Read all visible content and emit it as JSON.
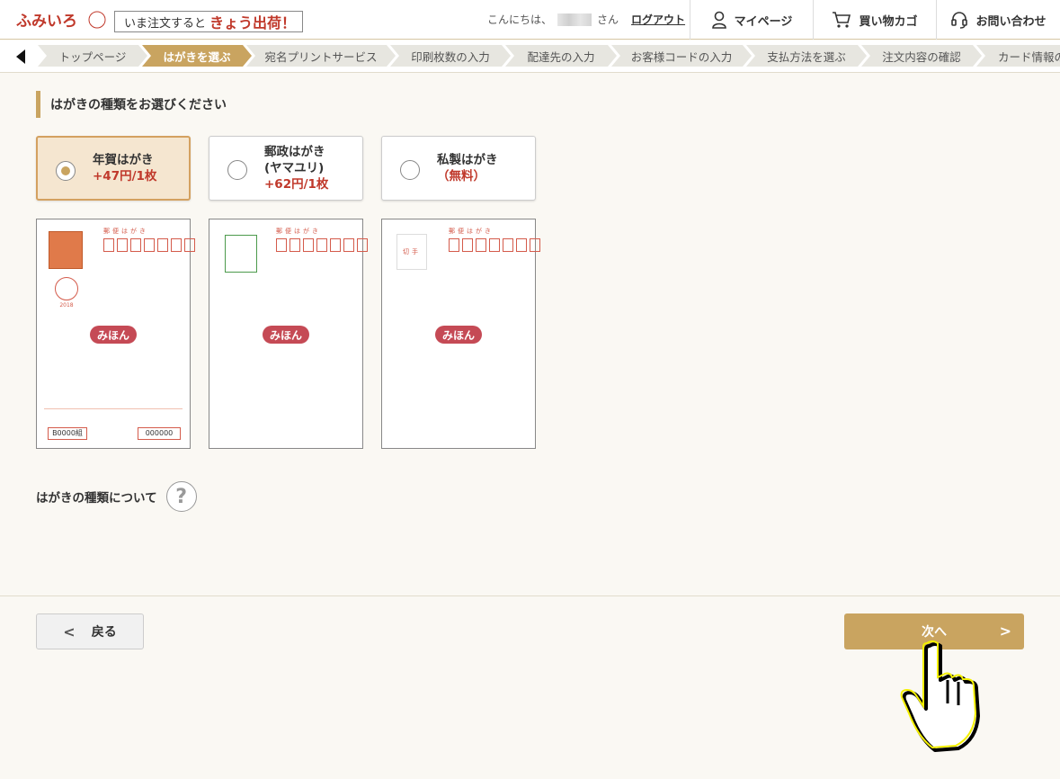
{
  "header": {
    "logo_text": "ふみいろ",
    "promo_prefix": "いま注文すると",
    "promo_strong": "きょう出荷！",
    "greeting_prefix": "こんにちは、",
    "greeting_suffix": "さん",
    "logout": "ログアウト",
    "nav": [
      {
        "label": "マイページ",
        "icon": "user-icon"
      },
      {
        "label": "買い物カゴ",
        "icon": "cart-icon"
      },
      {
        "label": "お問い合わせ",
        "icon": "headset-icon"
      }
    ]
  },
  "steps": [
    {
      "label": "トップページ",
      "active": false
    },
    {
      "label": "はがきを選ぶ",
      "active": true
    },
    {
      "label": "宛名プリントサービス",
      "active": false
    },
    {
      "label": "印刷枚数の入力",
      "active": false
    },
    {
      "label": "配達先の入力",
      "active": false
    },
    {
      "label": "お客様コードの入力",
      "active": false
    },
    {
      "label": "支払方法を選ぶ",
      "active": false
    },
    {
      "label": "注文内容の確認",
      "active": false
    },
    {
      "label": "カード情報の",
      "active": false
    }
  ],
  "main": {
    "section_title": "はがきの種類をお選びください",
    "options": [
      {
        "line1": "年賀はがき",
        "line2": "",
        "price": "+47円/1枚",
        "selected": true
      },
      {
        "line1": "郵政はがき",
        "line2": "(ヤマユリ)",
        "price": "+62円/1枚",
        "selected": false
      },
      {
        "line1": "私製はがき",
        "line2": "",
        "price": "（無料）",
        "selected": false
      }
    ],
    "sample_label": "みほん",
    "card_heading": "郵便はがき",
    "stamp_text": "切手",
    "card1_year": "2018",
    "card1_lot": "B0000組",
    "card1_number": "000000",
    "about_label": "はがきの種類について",
    "help_symbol": "?"
  },
  "footer": {
    "back_label": "戻る",
    "next_label": "次へ",
    "back_chevron": "<",
    "next_chevron": ">"
  },
  "colors": {
    "accent": "#c9a460",
    "price_red": "#c0392b",
    "sample_badge": "#c54a55",
    "selected_bg": "#f5e6d0"
  }
}
